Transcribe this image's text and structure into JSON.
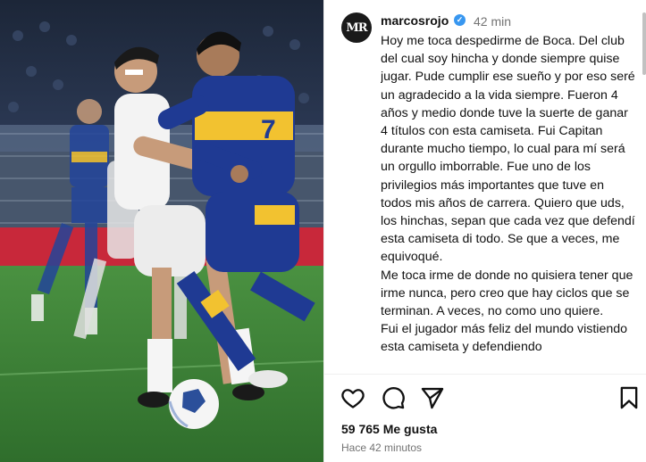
{
  "post": {
    "username": "marcosrojo",
    "avatar_initials": "MR",
    "time": "42 min",
    "verified_color": "#3897f0",
    "caption": [
      "Hoy me toca despedirme de Boca. Del club del cual soy hincha y donde siempre quise jugar. Pude cumplir ese sueño y por eso seré un agradecido a la vida siempre. Fueron 4 años y medio donde tuve la suerte de ganar 4 títulos con esta camiseta. Fui Capitan durante mucho tiempo, lo cual para mí será un orgullo imborrable. Fue uno de los privilegios más importantes que tuve en todos mis años de carrera. Quiero que uds, los hinchas, sepan que cada vez que defendí esta camiseta di todo. Se que a veces, me equivoqué.",
      "Me toca irme de donde no quisiera tener que irme nunca, pero creo que hay ciclos que se terminan. A veces, no como uno quiere.",
      "Fui el jugador más feliz del mundo vistiendo esta camiseta y defendiendo"
    ],
    "likes": "59 765 Me gusta",
    "posted_ago": "Hace 42 minutos"
  },
  "media": {
    "jersey_number": "7",
    "colors": {
      "boca_blue": "#1f3a93",
      "boca_gold": "#f2c230",
      "pitch": "#3f8a3a"
    }
  },
  "icons": [
    "heart-icon",
    "comment-icon",
    "share-icon",
    "bookmark-icon",
    "verified-icon"
  ]
}
